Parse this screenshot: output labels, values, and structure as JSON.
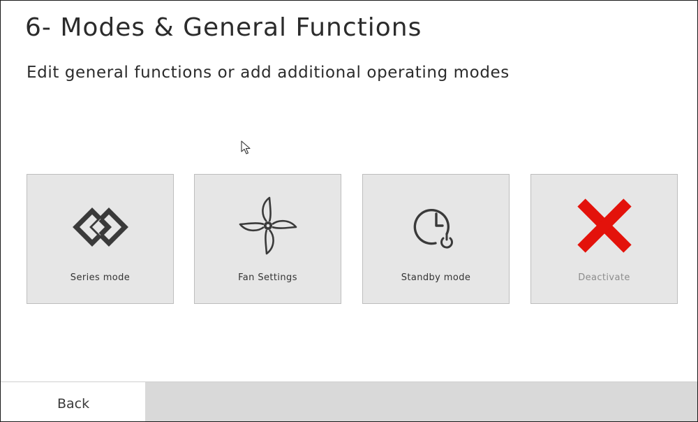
{
  "header": {
    "title": "6- Modes & General Functions",
    "subtitle": "Edit general functions or add additional operating modes"
  },
  "tiles": [
    {
      "label": "Series mode",
      "icon": "series-mode-icon",
      "enabled": true
    },
    {
      "label": "Fan Settings",
      "icon": "fan-icon",
      "enabled": true
    },
    {
      "label": "Standby mode",
      "icon": "clock-power-icon",
      "enabled": true
    },
    {
      "label": "Deactivate",
      "icon": "red-x-icon",
      "enabled": false
    }
  ],
  "footer": {
    "back_label": "Back"
  },
  "colors": {
    "tile_bg": "#e6e6e6",
    "icon_dark": "#3a3a3a",
    "deactivate_red": "#e3120b",
    "footer_bg": "#d9d9d9"
  }
}
